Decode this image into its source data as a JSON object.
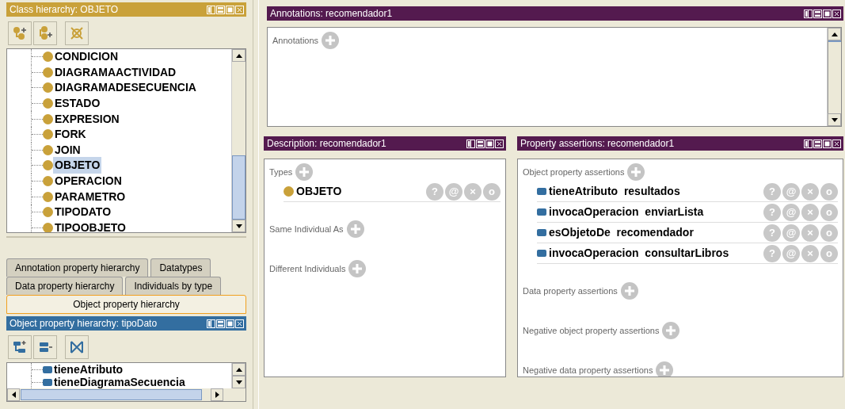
{
  "class_hierarchy": {
    "title": "Class hierarchy: OBJETO",
    "items": [
      {
        "label": "CONDICION",
        "selected": false
      },
      {
        "label": "DIAGRAMAACTIVIDAD",
        "selected": false
      },
      {
        "label": "DIAGRAMADESECUENCIA",
        "selected": false
      },
      {
        "label": "ESTADO",
        "selected": false
      },
      {
        "label": "EXPRESION",
        "selected": false
      },
      {
        "label": "FORK",
        "selected": false
      },
      {
        "label": "JOIN",
        "selected": false
      },
      {
        "label": "OBJETO",
        "selected": true
      },
      {
        "label": "OPERACION",
        "selected": false
      },
      {
        "label": "PARAMETRO",
        "selected": false
      },
      {
        "label": "TIPODATO",
        "selected": false
      },
      {
        "label": "TIPOOBJETO",
        "selected": false
      }
    ]
  },
  "hierarchy_tabs": [
    [
      {
        "label": "Annotation property hierarchy",
        "selected": false
      },
      {
        "label": "Datatypes",
        "selected": false
      }
    ],
    [
      {
        "label": "Data property hierarchy",
        "selected": false
      },
      {
        "label": "Individuals by type",
        "selected": false
      }
    ],
    [
      {
        "label": "Object property hierarchy",
        "selected": true
      }
    ]
  ],
  "object_property_hierarchy": {
    "title": "Object property hierarchy: tipoDato",
    "items": [
      {
        "label": "tieneAtributo"
      },
      {
        "label": "tieneDiagramaSecuencia"
      }
    ]
  },
  "annotations": {
    "title": "Annotations: recomendador1",
    "sections": [
      {
        "label": "Annotations"
      }
    ]
  },
  "description": {
    "title": "Description: recomendador1",
    "sections": [
      {
        "label": "Types",
        "items": [
          {
            "kind": "class",
            "text": "OBJETO",
            "actions": [
              "?",
              "@",
              "×",
              "o"
            ]
          }
        ]
      },
      {
        "label": "Same Individual As"
      },
      {
        "label": "Different Individuals"
      }
    ]
  },
  "property_assertions": {
    "title": "Property assertions: recomendador1",
    "sections": [
      {
        "label": "Object property assertions",
        "items": [
          {
            "kind": "property",
            "text": "tieneAtributo  resultados",
            "actions": [
              "?",
              "@",
              "×",
              "o"
            ]
          },
          {
            "kind": "property",
            "text": "invocaOperacion  enviarLista",
            "actions": [
              "?",
              "@",
              "×",
              "o"
            ]
          },
          {
            "kind": "property",
            "text": "esObjetoDe  recomendador",
            "actions": [
              "?",
              "@",
              "×",
              "o"
            ]
          },
          {
            "kind": "property",
            "text": "invocaOperacion  consultarLibros",
            "actions": [
              "?",
              "@",
              "×",
              "o"
            ]
          }
        ]
      },
      {
        "label": "Data property assertions"
      },
      {
        "label": "Negative object property assertions"
      },
      {
        "label": "Negative data property assertions"
      }
    ]
  }
}
